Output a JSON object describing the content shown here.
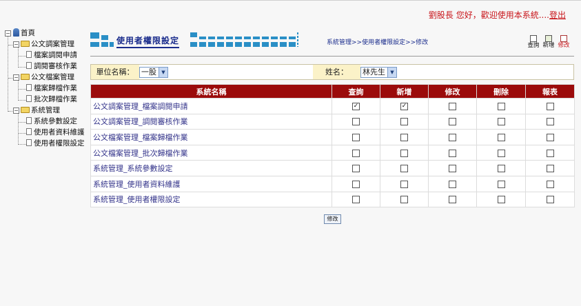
{
  "header": {
    "greeting": "劉股長 您好，歡迎使用本系統....",
    "logout_label": "登出"
  },
  "tree": {
    "root": "首頁",
    "groups": [
      {
        "label": "公文調案管理",
        "items": [
          "檔案調閱申請",
          "調閱審核作業"
        ]
      },
      {
        "label": "公文檔案管理",
        "items": [
          "檔案歸檔作業",
          "批次歸檔作業"
        ]
      },
      {
        "label": "系統管理",
        "items": [
          "系統參數設定",
          "使用者資料維護",
          "使用者權限設定"
        ]
      }
    ]
  },
  "page": {
    "title": "使用者權限設定",
    "breadcrumb": "系統管理>>使用者權限設定>>修改"
  },
  "toolbar": {
    "query_label": "查詢",
    "add_label": "新增",
    "edit_label": "修改"
  },
  "filter": {
    "unit_label": "單位名稱：",
    "unit_value": "一股",
    "name_label": "姓名：",
    "name_value": "林先生"
  },
  "table": {
    "headers": [
      "系統名稱",
      "查詢",
      "新增",
      "修改",
      "刪除",
      "報表"
    ],
    "rows": [
      {
        "name": "公文調案管理_檔案調閱申請",
        "perms": [
          true,
          true,
          false,
          false,
          false
        ]
      },
      {
        "name": "公文調案管理_調閱審核作業",
        "perms": [
          false,
          false,
          false,
          false,
          false
        ]
      },
      {
        "name": "公文檔案管理_檔案歸檔作業",
        "perms": [
          false,
          false,
          false,
          false,
          false
        ]
      },
      {
        "name": "公文檔案管理_批次歸檔作業",
        "perms": [
          false,
          false,
          false,
          false,
          false
        ]
      },
      {
        "name": "系統管理_系統參數設定",
        "perms": [
          false,
          false,
          false,
          false,
          false
        ]
      },
      {
        "name": "系統管理_使用者資料維護",
        "perms": [
          false,
          false,
          false,
          false,
          false
        ]
      },
      {
        "name": "系統管理_使用者權限設定",
        "perms": [
          false,
          false,
          false,
          false,
          false
        ]
      }
    ]
  },
  "actions": {
    "modify_label": "修改"
  }
}
